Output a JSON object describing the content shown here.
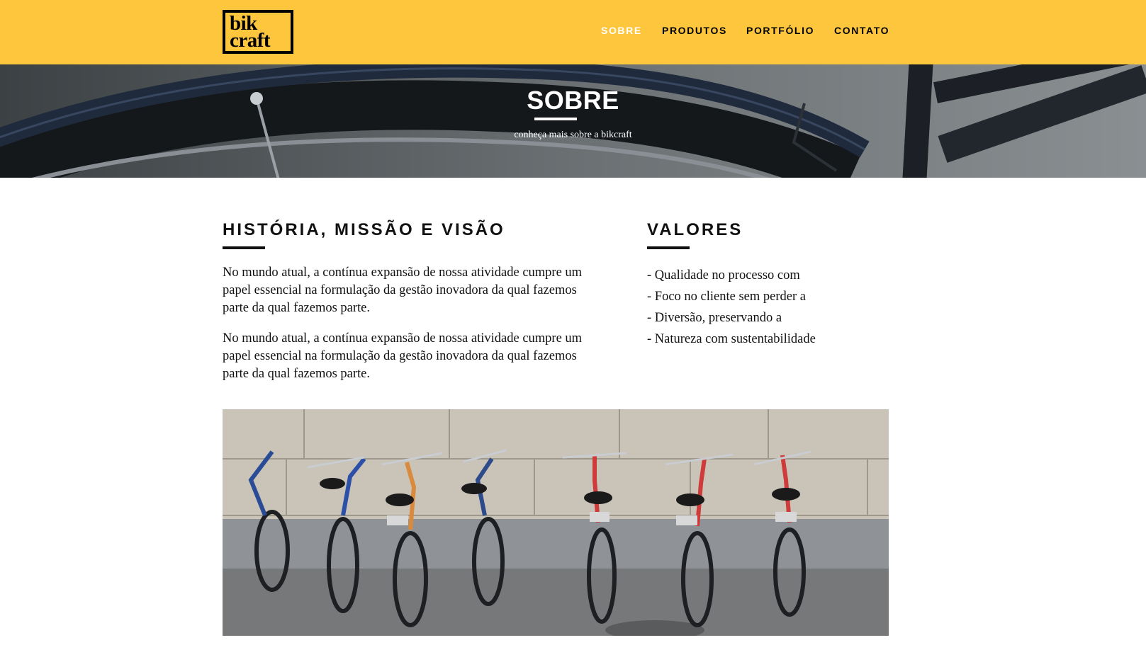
{
  "brand": {
    "logo_line1": "bik",
    "logo_line2": "craft"
  },
  "nav": {
    "items": [
      {
        "label": "SOBRE",
        "active": true
      },
      {
        "label": "PRODUTOS",
        "active": false
      },
      {
        "label": "PORTFÓLIO",
        "active": false
      },
      {
        "label": "CONTATO",
        "active": false
      }
    ]
  },
  "hero": {
    "title": "SOBRE",
    "subtitle": "conheça mais sobre a bikcraft"
  },
  "historia": {
    "title": "HISTÓRIA, MISSÃO E VISÃO",
    "paragraphs": [
      "No mundo atual, a contínua expansão de nossa atividade cumpre um papel essencial na formulação da gestão inovadora da qual fazemos parte da qual fazemos parte.",
      "No mundo atual, a contínua expansão de nossa atividade cumpre um papel essencial na formulação da gestão inovadora da qual fazemos parte da qual fazemos parte."
    ]
  },
  "valores": {
    "title": "VALORES",
    "items": [
      "- Qualidade no processo com",
      "- Foco no cliente sem perder a",
      "- Diversão, preservando a",
      "- Natureza com sustentabilidade"
    ]
  },
  "colors": {
    "brand_yellow": "#FEC63D",
    "text": "#111111",
    "hero_text": "#FFFFFF"
  }
}
